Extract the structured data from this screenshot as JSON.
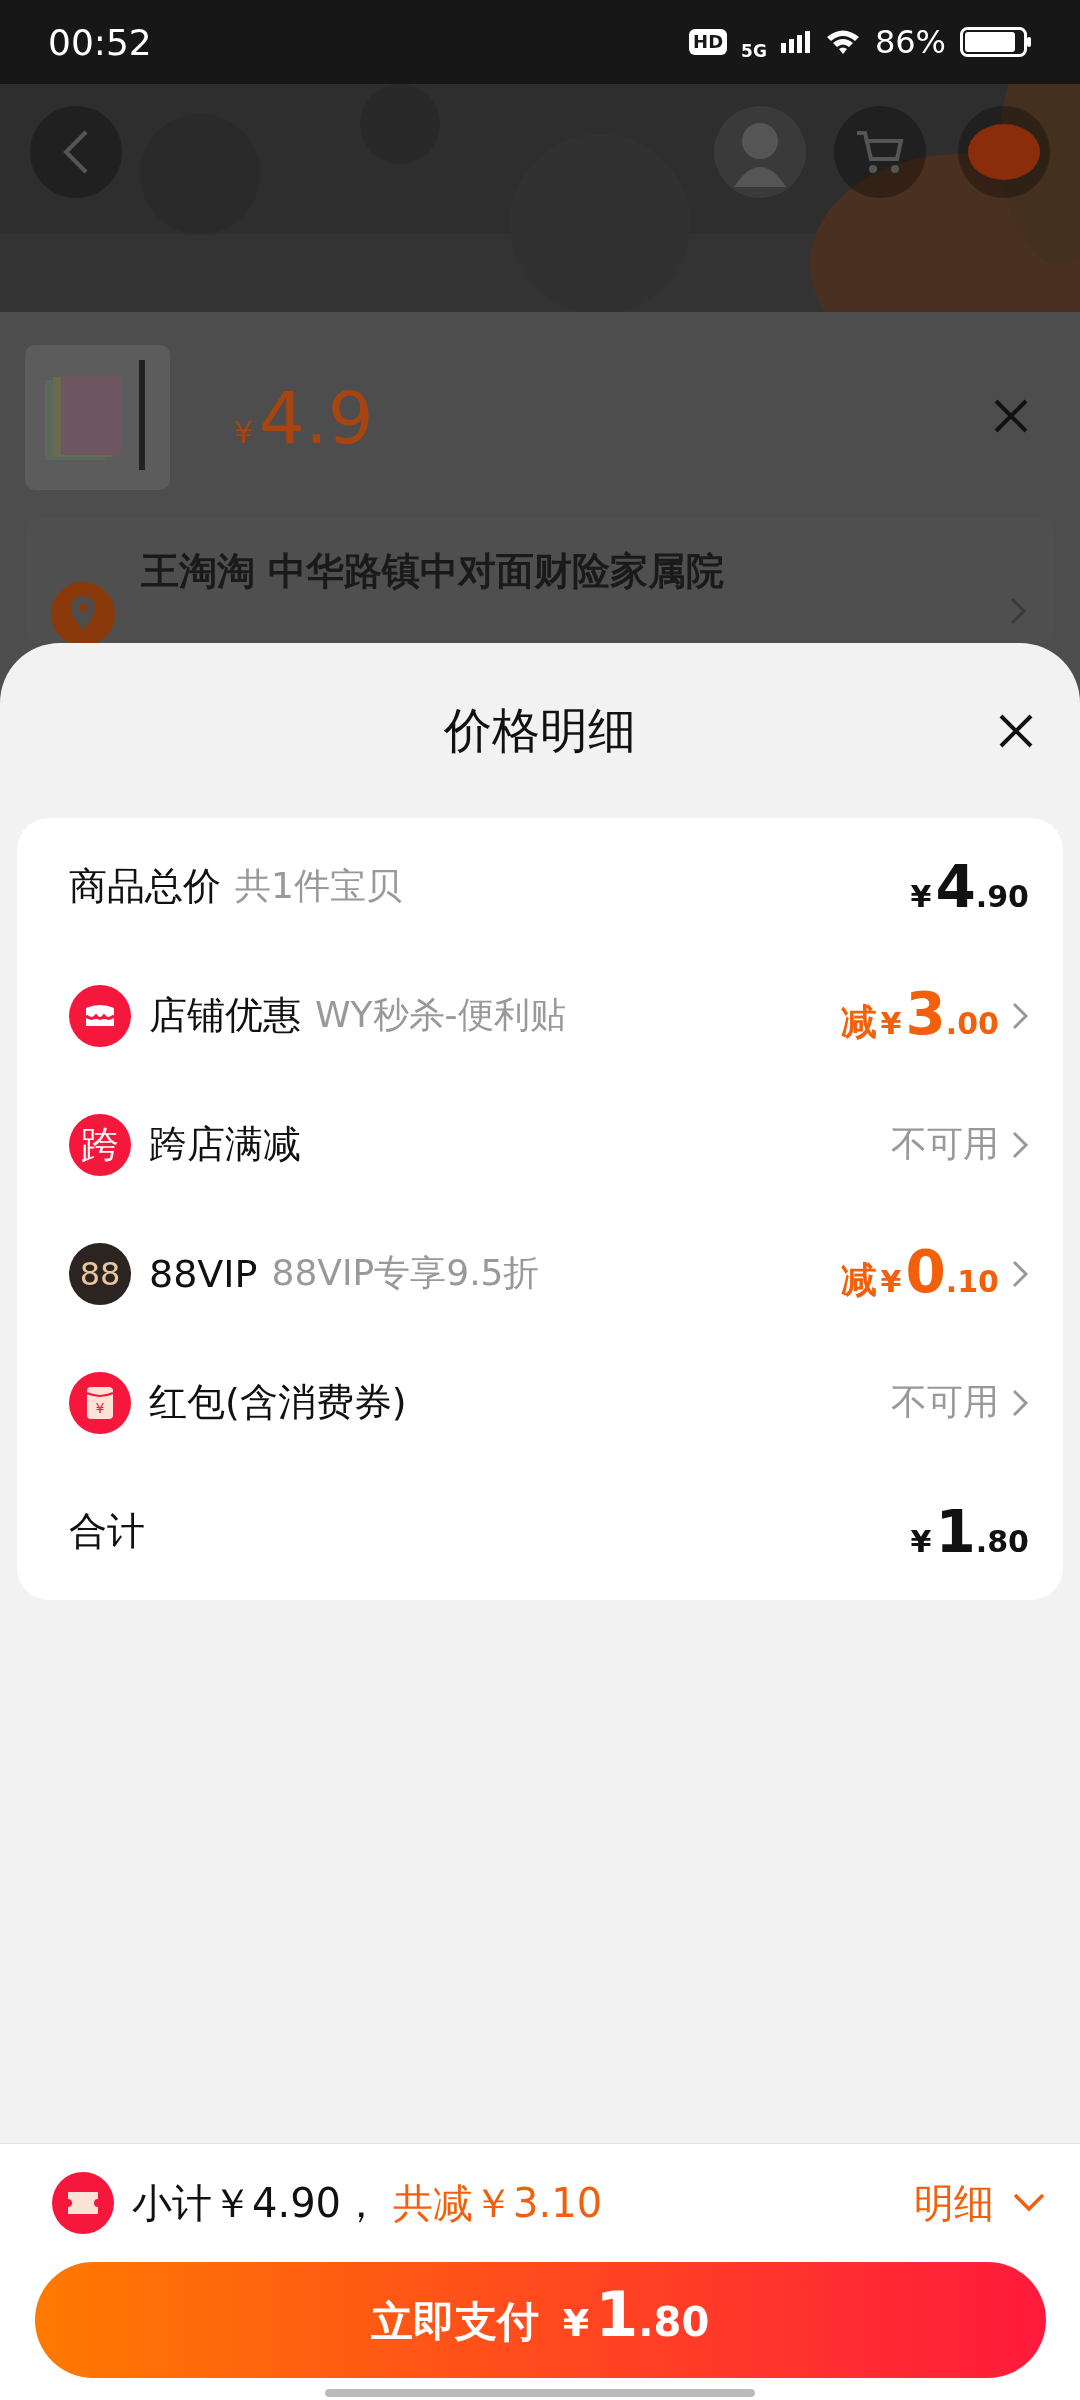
{
  "status_bar": {
    "time": "00:52",
    "hd": "HD",
    "network": "5G",
    "battery": "86%"
  },
  "product": {
    "currency": "¥",
    "price": "4.9"
  },
  "address": {
    "line": "王淘淘 中华路镇中对面财险家属院"
  },
  "sheet": {
    "title": "价格明细",
    "rows": [
      {
        "kind": "plain",
        "label": "商品总价",
        "note": "共1件宝贝",
        "value": {
          "kind": "amount",
          "currency": "¥",
          "integer": "4",
          "decimal": ".90",
          "highlight": false
        },
        "arrow": false
      },
      {
        "kind": "store",
        "color": "#f5173c",
        "label": "店铺优惠",
        "note": "WY秒杀-便利贴",
        "value": {
          "kind": "amount",
          "prefix": "减",
          "currency": "¥",
          "integer": "3",
          "decimal": ".00",
          "highlight": true
        },
        "arrow": true
      },
      {
        "kind": "text_badge",
        "color": "#f5173c",
        "badge": "跨",
        "label": "跨店满减",
        "value": {
          "kind": "status",
          "text": "不可用"
        },
        "arrow": true
      },
      {
        "kind": "text_badge",
        "color": "#2b2421",
        "badge": "88",
        "label": "88VIP",
        "note": "88VIP专享9.5折",
        "value": {
          "kind": "amount",
          "prefix": "减",
          "currency": "¥",
          "integer": "0",
          "decimal": ".10",
          "highlight": true
        },
        "arrow": true
      },
      {
        "kind": "envelope",
        "color": "#f5173c",
        "badge": "¥",
        "label": "红包(含消费券)",
        "value": {
          "kind": "status",
          "text": "不可用"
        },
        "arrow": true
      },
      {
        "kind": "plain",
        "label": "合计",
        "value": {
          "kind": "amount",
          "currency": "¥",
          "integer": "1",
          "decimal": ".80",
          "highlight": false
        },
        "arrow": false
      }
    ]
  },
  "footer": {
    "subtotal": "小计￥4.90，",
    "discount": "共减￥3.10",
    "details": "明细",
    "expanded": false,
    "pay_button": {
      "label": "立即支付",
      "currency": "¥",
      "integer": "1",
      "decimal": ".80"
    }
  }
}
